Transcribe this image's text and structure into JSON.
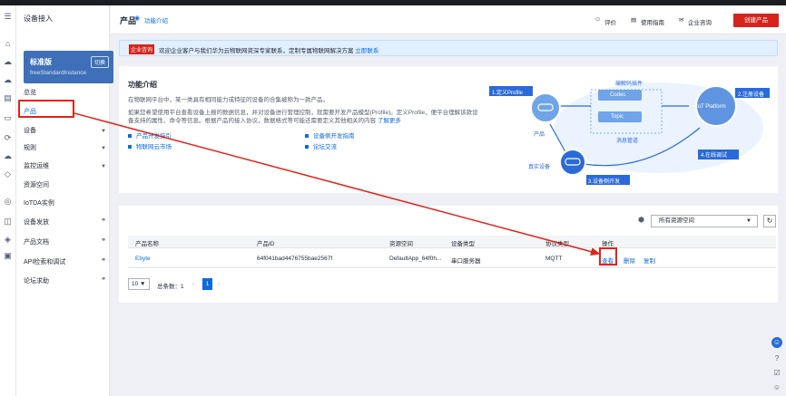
{
  "rail": {
    "icons": [
      "menu-icon",
      "home-icon",
      "cloud-icon",
      "cloud-icon",
      "chart-icon",
      "page-icon",
      "sync-icon",
      "compute-icon",
      "cloud-icon",
      "circle-icon",
      "grid-icon",
      "tag-icon",
      "badge-icon"
    ]
  },
  "sidebar": {
    "title": "设备接入",
    "plan_name": "标准版",
    "switch_label": "切换",
    "instance": "freeStandardInstance",
    "items": [
      {
        "label": "总览"
      },
      {
        "label": "产品"
      },
      {
        "label": "设备"
      },
      {
        "label": "规则"
      },
      {
        "label": "监控运维"
      },
      {
        "label": "资源空间"
      },
      {
        "label": "IoTDA实例"
      },
      {
        "label": "设备发放"
      },
      {
        "label": "产品文档"
      },
      {
        "label": "API检索和调试"
      },
      {
        "label": "论坛求助"
      }
    ]
  },
  "header": {
    "title": "产品",
    "intro_link": "功能介绍",
    "rate": "评价",
    "guide": "使用指南",
    "consult": "企业咨询",
    "create": "创建产品"
  },
  "banner": {
    "tag": "企业咨询",
    "text": "欢迎企业客户与我们华为云物联网资深专家联系，定制专属物联网解决方案",
    "link": "立即联系"
  },
  "intro": {
    "title": "功能介绍",
    "line1": "在物联网平台中，某一类具有相同能力或特征的设备的合集被称为一款产品。",
    "line2": "如果您希望使用平台查看设备上报的数据信息，并对设备进行管理控制，就需要开发产品模型(Profile)。定义Profile，便平台理解该款设",
    "line3": "备支持的属性、命令等信息。根据产品的接入协议，数据格式等可能还需要定义其他相关的内容",
    "more": "了解更多",
    "links": [
      "产品开发指引",
      "设备侧开发指南",
      "物联网云市场",
      "论坛交流"
    ]
  },
  "diagram": {
    "profile": "1.定义Profile",
    "codec_title": "编解码插件",
    "codec": "Codec",
    "topic": "Topic",
    "msg": "消息管道",
    "platform": "IoT Platform",
    "register": "2.注册设备",
    "online": "4.在线调试",
    "product": "产品",
    "device": "真实设备",
    "dev": "3.设备侧开发"
  },
  "table": {
    "space_select": "所有资源空间",
    "columns": [
      "产品名称",
      "产品ID",
      "资源空间",
      "设备类型",
      "协议类型",
      "操作"
    ],
    "rows": [
      {
        "name": "Ebyte",
        "id": "64f041bad4476755bae2567f",
        "space": "DefaultApp_64f0h...",
        "type": "串口服务器",
        "protocol": "MQTT",
        "view": "查看",
        "delete": "删除",
        "copy": "复制"
      }
    ],
    "page_size": "10",
    "total": "总条数：1",
    "page": "1"
  }
}
